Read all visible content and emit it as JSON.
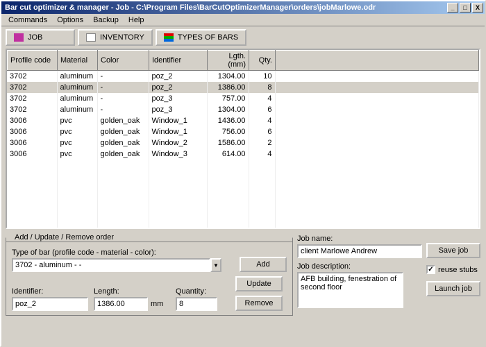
{
  "window": {
    "title": "Bar cut optimizer & manager - Job - C:\\Program Files\\BarCutOptimizerManager\\orders\\jobMarlowe.odr",
    "min": "_",
    "max": "□",
    "close": "X"
  },
  "menu": {
    "commands": "Commands",
    "options": "Options",
    "backup": "Backup",
    "help": "Help"
  },
  "tabs": {
    "job": "JOB",
    "inventory": "INVENTORY",
    "types": "TYPES OF BARS"
  },
  "grid": {
    "headers": {
      "profile": "Profile code",
      "material": "Material",
      "color": "Color",
      "identifier": "Identifier",
      "length": "Lgth. (mm)",
      "qty": "Qty."
    },
    "rows": [
      {
        "profile": "3702",
        "material": "aluminum",
        "color": "-",
        "identifier": "poz_2",
        "length": "1304.00",
        "qty": "10",
        "sel": false
      },
      {
        "profile": "3702",
        "material": "aluminum",
        "color": "-",
        "identifier": "poz_2",
        "length": "1386.00",
        "qty": "8",
        "sel": true
      },
      {
        "profile": "3702",
        "material": "aluminum",
        "color": "-",
        "identifier": "poz_3",
        "length": "757.00",
        "qty": "4",
        "sel": false
      },
      {
        "profile": "3702",
        "material": "aluminum",
        "color": "-",
        "identifier": "poz_3",
        "length": "1304.00",
        "qty": "6",
        "sel": false
      },
      {
        "profile": "3006",
        "material": "pvc",
        "color": "golden_oak",
        "identifier": "Window_1",
        "length": "1436.00",
        "qty": "4",
        "sel": false
      },
      {
        "profile": "3006",
        "material": "pvc",
        "color": "golden_oak",
        "identifier": "Window_1",
        "length": "756.00",
        "qty": "6",
        "sel": false
      },
      {
        "profile": "3006",
        "material": "pvc",
        "color": "golden_oak",
        "identifier": "Window_2",
        "length": "1586.00",
        "qty": "2",
        "sel": false
      },
      {
        "profile": "3006",
        "material": "pvc",
        "color": "golden_oak",
        "identifier": "Window_3",
        "length": "614.00",
        "qty": "4",
        "sel": false
      }
    ]
  },
  "form": {
    "legend": "Add / Update / Remove order",
    "type_label": "Type of bar (profile code - material - color):",
    "type_value": "3702 - aluminum - -",
    "identifier_label": "Identifier:",
    "identifier_value": "poz_2",
    "length_label": "Length:",
    "length_value": "1386.00",
    "length_unit": "mm",
    "qty_label": "Quantity:",
    "qty_value": "8",
    "add": "Add",
    "update": "Update",
    "remove": "Remove"
  },
  "job": {
    "name_label": "Job name:",
    "name_value": "client Marlowe Andrew",
    "desc_label": "Job description:",
    "desc_value": "AFB building, fenestration of second floor",
    "save": "Save job",
    "reuse": "reuse stubs",
    "reuse_checked": "✓",
    "launch": "Launch job"
  }
}
